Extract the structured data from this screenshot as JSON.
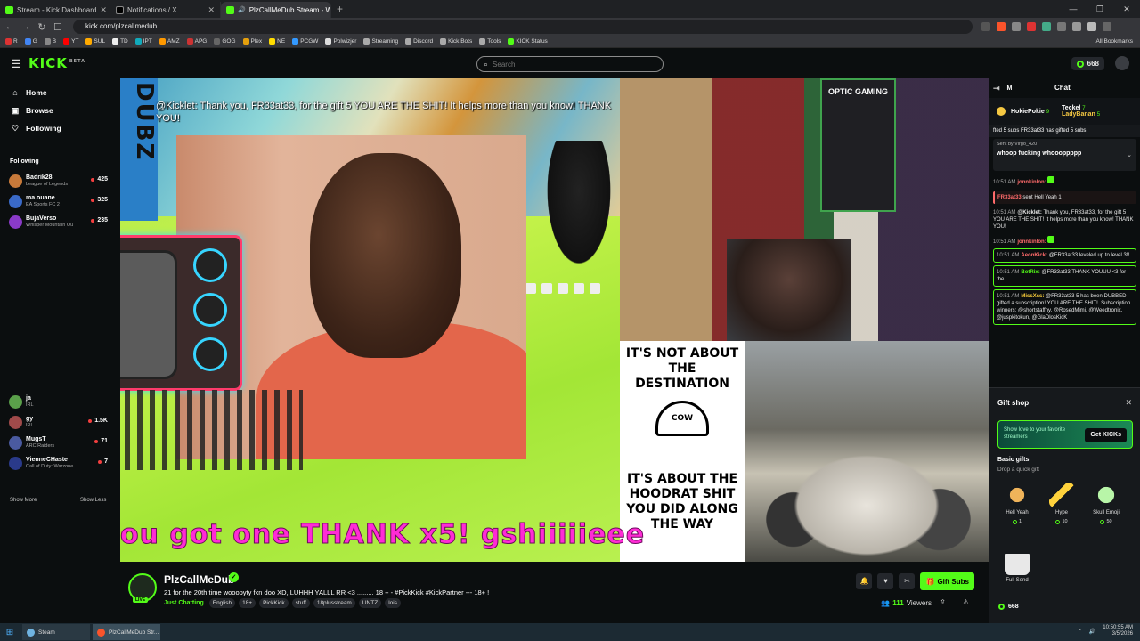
{
  "browser": {
    "tabs": [
      {
        "title": "Stream - Kick Dashboard",
        "favicon_color": "#53fc18",
        "active": false
      },
      {
        "title": "Notifications / X",
        "favicon_color": "#ffffff",
        "active": false
      },
      {
        "title": "PlzCallMeDub Stream - Watc",
        "favicon_color": "#53fc18",
        "active": true
      }
    ],
    "url": "kick.com/plzcallmedub",
    "bookmarks": [
      "R",
      "G",
      "B",
      "YT",
      "SUL",
      "TD",
      "IPT",
      "AMZ",
      "APG",
      "GOG",
      "Plex",
      "NE",
      "PCGW",
      "Polwizjer",
      "Streaming",
      "Discord",
      "Kick Bots",
      "Tools",
      "KICK Status"
    ],
    "all_bookmarks": "All Bookmarks"
  },
  "kick": {
    "logo": "KICK",
    "logo_badge": "BETA",
    "search_placeholder": "Search",
    "coins": "668",
    "accent": "#53fc18"
  },
  "sidebar": {
    "nav": [
      {
        "label": "Home",
        "icon": "home-icon"
      },
      {
        "label": "Browse",
        "icon": "browse-icon"
      },
      {
        "label": "Following",
        "icon": "heart-icon"
      }
    ],
    "following_header": "Following",
    "following": [
      {
        "name": "Badrik28",
        "category": "League of Legends",
        "viewers": "425",
        "color": "#c87a3a"
      },
      {
        "name": "ma.ouane",
        "category": "EA Sports FC 2",
        "viewers": "325",
        "color": "#3a6ac8"
      },
      {
        "name": "BujaVerso",
        "category": "Whisper Mountain Ou",
        "viewers": "235",
        "color": "#8a3ac8"
      }
    ],
    "following_lower": [
      {
        "name": "ja",
        "category": "IRL",
        "viewers": "",
        "color": "#5aa04a"
      },
      {
        "name": "gy",
        "category": "IRL",
        "viewers": "1.5K",
        "color": "#a04a4a"
      },
      {
        "name": "MugsT",
        "category": "ARC Raiders",
        "viewers": "71",
        "color": "#4a5aa0"
      },
      {
        "name": "VienneCHaste",
        "category": "Call of Duty: Warzone",
        "viewers": "7",
        "color": "#2a3a8a"
      }
    ],
    "show_more": "Show More",
    "show_less": "Show Less"
  },
  "video": {
    "overlay_text": "@Kicklet: Thank you, FR33at33, for the gift 5 YOU ARE THE SHIT! It helps more than you know! THANK YOU!",
    "side_text": "DUBZ",
    "ticker": "ou got one THANK x5! gshiiiiieee",
    "quote_top": "IT'S NOT ABOUT THE DESTINATION",
    "quote_bottom": "IT'S ABOUT THE HOODRAT SHIT YOU DID ALONG THE WAY",
    "cap_text": "COW",
    "poster_text": "OPTIC GAMING"
  },
  "stream": {
    "channel": "PlzCallMeDub",
    "live_badge": "LIVE",
    "title": "21 for the 20th time wooopyty fkn doo XD, LUHHH YALLL RR <3    .........  18 + - #PickKick #KickPartner --- 18+ !",
    "category": "Just Chatting",
    "tags": [
      "English",
      "18+",
      "PickKick",
      "stuff",
      "18plusstream",
      "UNTZ",
      "lois"
    ],
    "gift_subs": "Gift Subs",
    "viewers": "111",
    "viewers_label": "Viewers"
  },
  "chat": {
    "title": "Chat",
    "mode": "M",
    "leaderboard": [
      {
        "name": "HokiePokie",
        "count": "9"
      },
      {
        "name": "Teckel",
        "count": "7"
      },
      {
        "name": "LadyBanan",
        "count": "5"
      }
    ],
    "gifted_banner": "fted 5 subs   FR33at33 has gifted 5 subs",
    "pinned_by": "Sent by  Virgo_420",
    "pinned_msg": "whoop fucking whoooppppp",
    "messages": [
      {
        "ts": "10:51 AM",
        "user": "jonnkinlon:",
        "text": "",
        "user_color": "#ff6b6b",
        "style": "plain"
      },
      {
        "ts": "",
        "user": "FR33at33",
        "text": "sent Hell Yeah  1",
        "user_color": "#ff6b6b",
        "style": "red"
      },
      {
        "ts": "10:51 AM",
        "user": "@Kicklet:",
        "text": "Thank you, FR33at33, for the gift 5 YOU ARE THE SHIT! It helps more than you know! THANK YOU!",
        "user_color": "#ffffff",
        "style": "plain"
      },
      {
        "ts": "10:51 AM",
        "user": "jonnkinlon:",
        "text": "",
        "user_color": "#ff6b6b",
        "style": "plain"
      },
      {
        "ts": "10:51 AM",
        "user": "AeonKick:",
        "text": "@FR33at33 leveled up to level 3!!",
        "user_color": "#ff6b6b",
        "style": "green"
      },
      {
        "ts": "10:51 AM",
        "user": "BotRix:",
        "text": "@FR33at33 THANK YOUUU <3 for the",
        "user_color": "#53fc18",
        "style": "green"
      },
      {
        "ts": "10:51 AM",
        "user": "MissXss:",
        "text": "@FR33at33 5 has been DUBBED gifted a subscription! YOU ARE THE SHIT!. Subscription winners; @shortstaffny, @RosedMimi, @Weedtronix, @juspkitokun, @GlaDlosKicK",
        "user_color": "#ffd23c",
        "style": "green"
      }
    ]
  },
  "giftshop": {
    "title": "Gift shop",
    "promo": "Show love to your favorite streamers",
    "get_kicks": "Get KICKs",
    "basic": "Basic gifts",
    "drop": "Drop a quick gift",
    "gifts": [
      {
        "name": "Hell Yeah",
        "price": "1",
        "color": "#f0b45a"
      },
      {
        "name": "Hype",
        "price": "10",
        "color": "#ffd23c"
      },
      {
        "name": "Skull Emoji",
        "price": "50",
        "color": "#b8f5a8"
      },
      {
        "name": "Full Send",
        "price": "",
        "color": "#e8e8e8"
      }
    ],
    "balance": "668"
  },
  "taskbar": {
    "tasks": [
      {
        "label": "Steam",
        "color": "#6fb3e0"
      },
      {
        "label": "PlzCallMeDub Str...",
        "color": "#fb542b"
      }
    ],
    "time": "10:50:55 AM",
    "date": "3/5/2026"
  }
}
